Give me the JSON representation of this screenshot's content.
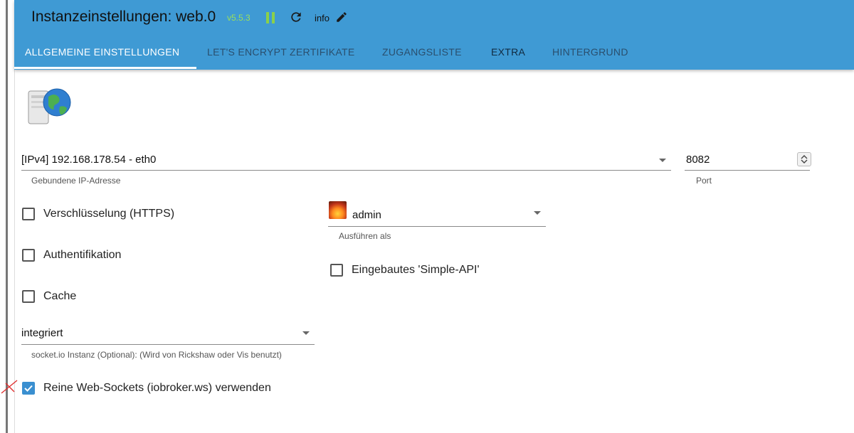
{
  "header": {
    "title": "Instanzeinstellungen: web.0",
    "version": "v5.5.3",
    "log_level": "info",
    "brand_color": "#3f9ad4",
    "version_color": "#9be05a"
  },
  "tabs": [
    {
      "label": "ALLGEMEINE EINSTELLUNGEN",
      "active": true
    },
    {
      "label": "LET'S ENCRYPT ZERTIFIKATE",
      "active": false
    },
    {
      "label": "ZUGANGSLISTE",
      "active": false
    },
    {
      "label": "EXTRA",
      "active": false
    },
    {
      "label": "HINTERGRUND",
      "active": false
    }
  ],
  "form": {
    "bind": {
      "value": "[IPv4] 192.168.178.54 - eth0",
      "label": "Gebundene IP-Adresse"
    },
    "port": {
      "value": "8082",
      "label": "Port"
    },
    "https": {
      "label": "Verschlüsselung (HTTPS)",
      "checked": false
    },
    "auth": {
      "label": "Authentifikation",
      "checked": false
    },
    "cache": {
      "label": "Cache",
      "checked": false
    },
    "run_as": {
      "value": "admin",
      "label": "Ausführen als"
    },
    "simple_api": {
      "label": "Eingebautes 'Simple-API'",
      "checked": false
    },
    "socketio": {
      "value": "integriert",
      "label": "socket.io Instanz (Optional): (Wird von Rickshaw oder Vis benutzt)"
    },
    "pure_ws": {
      "label": "Reine Web-Sockets (iobroker.ws) verwenden",
      "checked": true
    }
  },
  "icons": {
    "pause": "pause-icon",
    "reload": "reload-icon",
    "edit": "pencil-icon",
    "adapter": "web-server-globe-icon",
    "user": "user-avatar-icon",
    "annotation": "red-x-mark"
  }
}
